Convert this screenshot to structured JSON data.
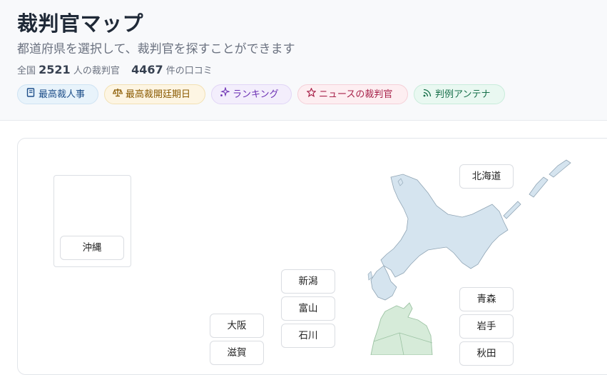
{
  "header": {
    "title": "裁判官マップ",
    "subtitle": "都道府県を選択して、裁判官を探すことができます",
    "stats": {
      "prefix": "全国",
      "judges_count": "2521",
      "judges_unit": "人の裁判官",
      "reviews_count": "4467",
      "reviews_unit": "件の口コミ"
    }
  },
  "nav": [
    {
      "label": "最高裁人事",
      "icon": "book-icon"
    },
    {
      "label": "最高裁開廷期日",
      "icon": "scales-icon"
    },
    {
      "label": "ランキング",
      "icon": "sparkle-icon"
    },
    {
      "label": "ニュースの裁判官",
      "icon": "star-icon"
    },
    {
      "label": "判例アンテナ",
      "icon": "rss-icon"
    }
  ],
  "map": {
    "prefectures": {
      "okinawa": "沖縄",
      "hokkaido": "北海道",
      "niigata": "新潟",
      "toyama": "富山",
      "ishikawa": "石川",
      "osaka": "大阪",
      "shiga": "滋賀",
      "aomori": "青森",
      "iwate": "岩手",
      "akita": "秋田"
    },
    "colors": {
      "hokkaido": "#d5e4ef",
      "tohoku": "#d6ebd9",
      "okinawa": "#f6d9d5"
    }
  }
}
